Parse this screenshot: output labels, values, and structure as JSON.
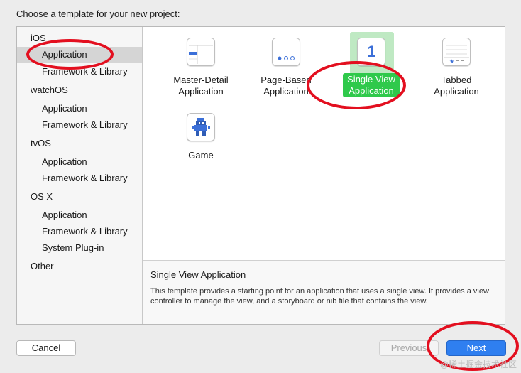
{
  "dialog": {
    "title": "Choose a template for your new project:"
  },
  "sidebar": {
    "groups": [
      {
        "platform": "iOS",
        "items": [
          "Application",
          "Framework & Library"
        ]
      },
      {
        "platform": "watchOS",
        "items": [
          "Application",
          "Framework & Library"
        ]
      },
      {
        "platform": "tvOS",
        "items": [
          "Application",
          "Framework & Library"
        ]
      },
      {
        "platform": "OS X",
        "items": [
          "Application",
          "Framework & Library",
          "System Plug-in"
        ]
      },
      {
        "platform": "Other",
        "items": []
      }
    ],
    "selected": "iOS / Application"
  },
  "templates": [
    {
      "label_line1": "Master-Detail",
      "label_line2": "Application",
      "icon": "master-detail-icon"
    },
    {
      "label_line1": "Page-Based",
      "label_line2": "Application",
      "icon": "page-based-icon"
    },
    {
      "label_line1": "Single View",
      "label_line2": "Application",
      "icon": "single-view-icon",
      "icon_text": "1",
      "selected": true
    },
    {
      "label_line1": "Tabbed",
      "label_line2": "Application",
      "icon": "tabbed-icon"
    },
    {
      "label_line1": "Game",
      "label_line2": "",
      "icon": "game-icon"
    }
  ],
  "description": {
    "title": "Single View Application",
    "text": "This template provides a starting point for an application that uses a single view. It provides a view controller to manage the view, and a storyboard or nib file that contains the view."
  },
  "buttons": {
    "cancel": "Cancel",
    "previous": "Previous",
    "next": "Next"
  },
  "watermark": "@稀土掘金技术社区",
  "colors": {
    "annotation_ring": "#e30f1f",
    "selection_green": "#2fc94b",
    "next_button": "#2f7ff0"
  }
}
